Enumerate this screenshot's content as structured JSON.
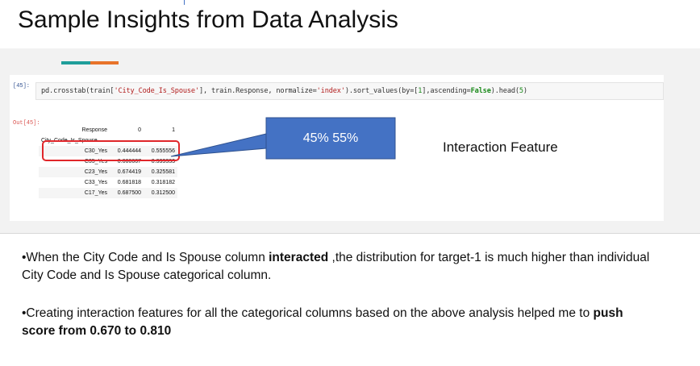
{
  "slide": {
    "title": "Sample Insights from Data Analysis",
    "colors": {
      "accent_teal": "#1f9e9a",
      "accent_orange": "#e8732a",
      "callout_fill": "#4472c4",
      "highlight_border": "#e0262a"
    }
  },
  "notebook": {
    "in_prompt": "[45]:",
    "code": {
      "p1": "pd.crosstab(train[",
      "s1": "'City_Code_Is_Spouse'",
      "p2": "], train.Response, normalize=",
      "s2": "'index'",
      "p3": ").sort_values(by=[",
      "n1": "1",
      "p4": "],ascending=",
      "k1": "False",
      "p5": ").head(",
      "n2": "5",
      "p6": ")"
    },
    "out_prompt": "Out[45]:",
    "table": {
      "columns_label": "Response",
      "columns": [
        "0",
        "1"
      ],
      "index_name": "City_Code_Is_Spouse",
      "rows": [
        {
          "index": "C30_Yes",
          "v0": "0.444444",
          "v1": "0.555556"
        },
        {
          "index": "C35_Yes",
          "v0": "0.666667",
          "v1": "0.333333"
        },
        {
          "index": "C23_Yes",
          "v0": "0.674419",
          "v1": "0.325581"
        },
        {
          "index": "C33_Yes",
          "v0": "0.681818",
          "v1": "0.318182"
        },
        {
          "index": "C17_Yes",
          "v0": "0.687500",
          "v1": "0.312500"
        }
      ]
    }
  },
  "callout": {
    "text": "45% 55%"
  },
  "side_label": "Interaction Feature",
  "bullets": [
    {
      "a": "•When the City Code and Is Spouse column ",
      "b": "interacted",
      "c": " ,the distribution for target-1 is much higher than individual City Code and Is Spouse categorical column."
    },
    {
      "a": "•Creating interaction features for all the categorical columns based on the above analysis helped me to ",
      "b": "push score from 0.670 to 0.810",
      "c": ""
    }
  ]
}
